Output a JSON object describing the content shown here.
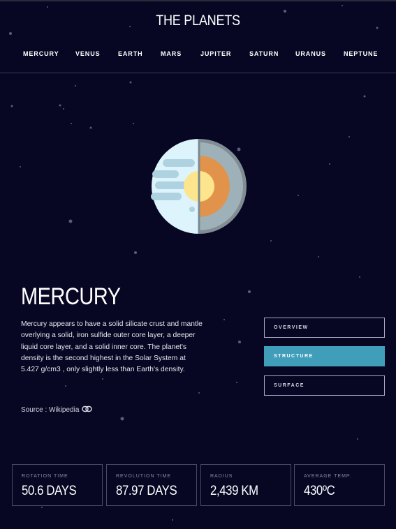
{
  "site_title": "THE PLANETS",
  "nav": [
    "MERCURY",
    "VENUS",
    "EARTH",
    "MARS",
    "JUPITER",
    "SATURN",
    "URANUS",
    "NEPTUNE"
  ],
  "planet": {
    "name": "MERCURY",
    "description": "Mercury appears to have a solid silicate crust and mantle overlying a solid, iron sulfide outer core layer, a deeper liquid core layer, and a solid inner core. The planet's density is the second highest in the Solar System at 5.427 g/cm3 , only slightly less than Earth's density.",
    "source_label": "Source : ",
    "source_link": "Wikipedia"
  },
  "tabs": [
    {
      "label": "OVERVIEW",
      "active": false
    },
    {
      "label": "STRUCTURE",
      "active": true
    },
    {
      "label": "SURFACE",
      "active": false
    }
  ],
  "stats": [
    {
      "label": "ROTATION TIME",
      "value": "50.6 DAYS"
    },
    {
      "label": "REVOLUTION TIME",
      "value": "87.97 DAYS"
    },
    {
      "label": "RADIUS",
      "value": "2,439 KM"
    },
    {
      "label": "AVERAGE TEMP.",
      "value": "430ºC"
    }
  ],
  "colors": {
    "background": "#070724",
    "active_tab": "#419ebb",
    "planet_surface": "#def4fc",
    "planet_cloud": "#afd2e0",
    "mantle": "#9fb1b8",
    "outer_core": "#e1934c",
    "inner_core": "#fce58c"
  },
  "icons": {
    "source_link": "link-icon"
  }
}
